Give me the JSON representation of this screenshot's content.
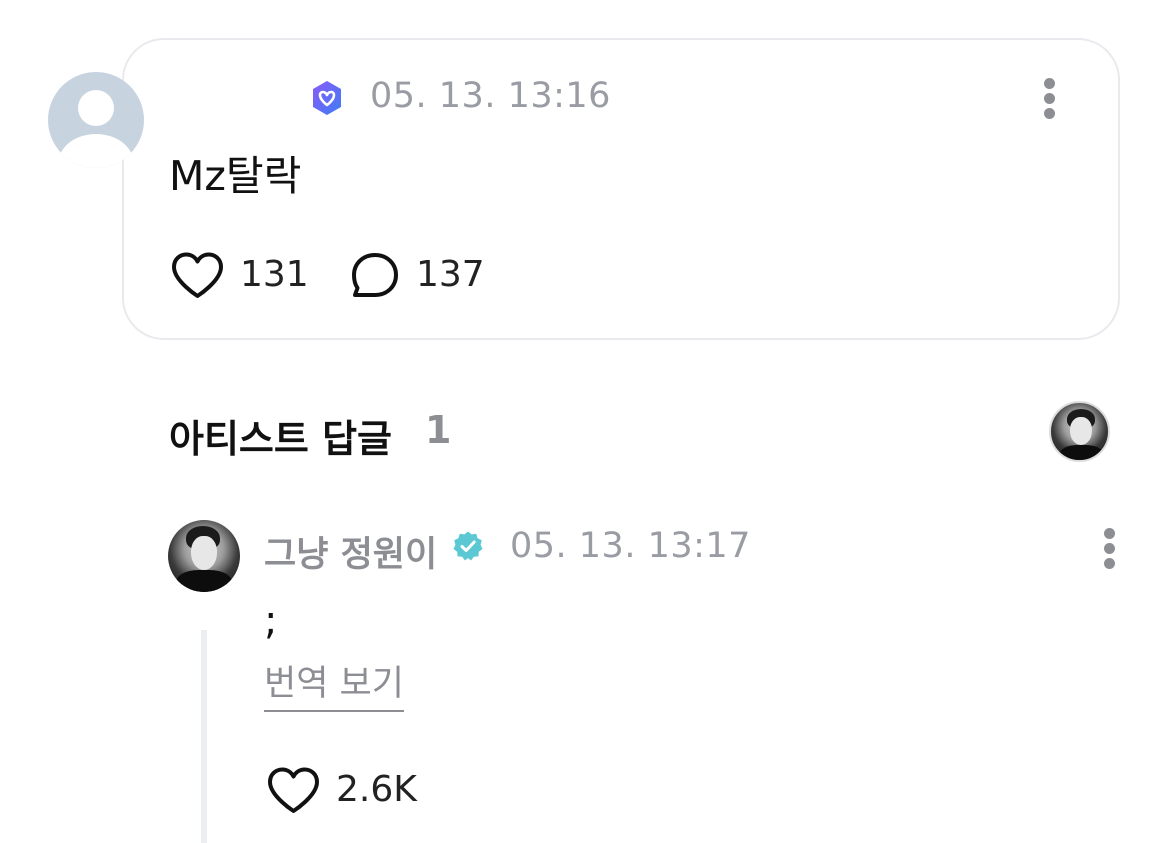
{
  "post": {
    "timestamp": "05. 13. 13:16",
    "text": "Mz탈락",
    "likes": "131",
    "comments": "137"
  },
  "artist_replies": {
    "title": "아티스트 답글",
    "count": "1"
  },
  "reply": {
    "author": "그냥 정원이",
    "timestamp": "05. 13. 13:17",
    "text": ";",
    "translate_label": "번역 보기",
    "likes": "2.6K"
  },
  "colors": {
    "muted_text": "#8c8e94",
    "verified_badge": "#5cc8d4",
    "fan_badge_gradient": [
      "#7a5cf5",
      "#3f7bf5"
    ],
    "card_border": "#e9eaee"
  }
}
